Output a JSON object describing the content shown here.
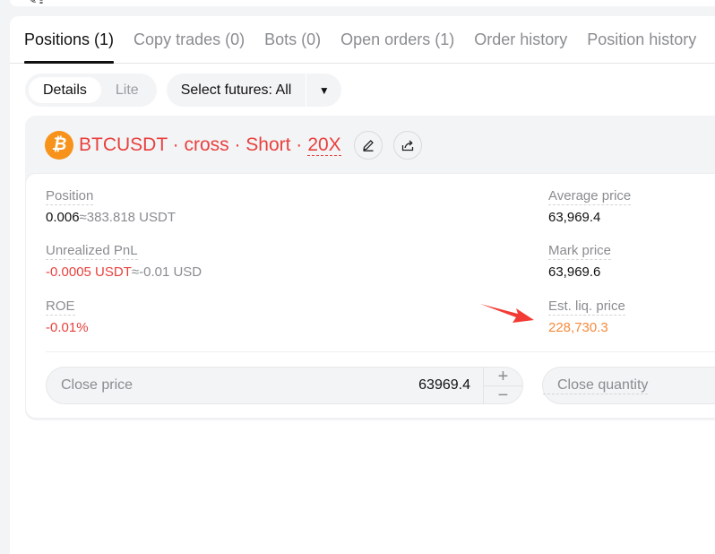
{
  "top_strip": {
    "icons": [
      "edit-icon",
      "share-icon"
    ]
  },
  "tabs": [
    {
      "label": "Positions (1)",
      "active": true
    },
    {
      "label": "Copy trades (0)",
      "active": false
    },
    {
      "label": "Bots (0)",
      "active": false
    },
    {
      "label": "Open orders (1)",
      "active": false
    },
    {
      "label": "Order history",
      "active": false
    },
    {
      "label": "Position history",
      "active": false
    }
  ],
  "toolbar": {
    "view_modes": [
      {
        "label": "Details",
        "active": true
      },
      {
        "label": "Lite",
        "active": false
      }
    ],
    "futures_select": {
      "label": "Select futures: All",
      "caret": "▼"
    }
  },
  "position": {
    "coin_icon": "₿",
    "title": "BTCUSDT · cross · Short · ",
    "leverage": "20X",
    "colors": {
      "short": "#e8413e",
      "liq": "#f68a3c",
      "btc": "#f7931a"
    },
    "fields": {
      "position": {
        "label": "Position",
        "value": "0.006",
        "approx": "≈383.818 USDT"
      },
      "unrealized_pnl": {
        "label": "Unrealized PnL",
        "value": "-0.0005 USDT",
        "approx": "≈-0.01 USD"
      },
      "roe": {
        "label": "ROE",
        "value": "-0.01%"
      },
      "average_price": {
        "label": "Average price",
        "value": "63,969.4"
      },
      "mark_price": {
        "label": "Mark price",
        "value": "63,969.6"
      },
      "est_liq_price": {
        "label": "Est. liq. price",
        "value": "228,730.3"
      }
    },
    "close_price": {
      "label": "Close price",
      "value": "63969.4",
      "plus": "+",
      "minus": "−"
    },
    "close_quantity": {
      "label": "Close quantity"
    }
  }
}
